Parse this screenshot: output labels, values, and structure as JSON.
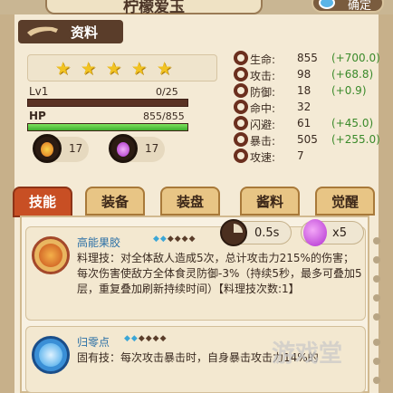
{
  "header": {
    "title": "柠檬爱玉",
    "top_button": "确定"
  },
  "section": {
    "label": "资料"
  },
  "card": {
    "stars": 5,
    "level": {
      "label": "Lv1",
      "value": "0/25",
      "fraction": 0.0
    },
    "hp": {
      "label": "HP",
      "value": "855/855",
      "fraction": 1.0
    },
    "resource_a": "17",
    "resource_b": "17"
  },
  "stats": [
    {
      "name": "生命:",
      "value": "855",
      "bonus": "(+700.0)"
    },
    {
      "name": "攻击:",
      "value": "98",
      "bonus": "(+68.8)"
    },
    {
      "name": "防御:",
      "value": "18",
      "bonus": "(+0.9)"
    },
    {
      "name": "命中:",
      "value": "32",
      "bonus": ""
    },
    {
      "name": "闪避:",
      "value": "61",
      "bonus": "(+45.0)"
    },
    {
      "name": "暴击:",
      "value": "505",
      "bonus": "(+255.0)"
    },
    {
      "name": "攻速:",
      "value": "7",
      "bonus": ""
    }
  ],
  "tabs": [
    {
      "label": "技能",
      "active": true
    },
    {
      "label": "装备",
      "active": false
    },
    {
      "label": "装盘",
      "active": false
    },
    {
      "label": "酱料",
      "active": false
    },
    {
      "label": "觉醒",
      "active": false
    }
  ],
  "skill_badges": {
    "cooldown": "0.5s",
    "count": "x5"
  },
  "skills": [
    {
      "name": "高能果胶",
      "desc": "料理技：对全体敌人造成5次，总计攻击力215%的伤害；每次伤害使敌方全体食灵防御-3%（持续5秒，最多可叠加5层，重复叠加刷新持续时间）【料理技次数:1】"
    },
    {
      "name": "归零点",
      "desc": "固有技：每次攻击暴击时，自身暴击攻击力14%的"
    }
  ],
  "watermark": "游戏堂"
}
